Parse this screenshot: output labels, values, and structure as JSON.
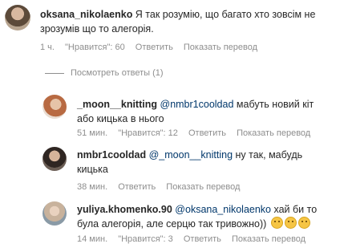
{
  "comments": [
    {
      "username": "oksana_nikolaenko",
      "text_line1": " Я так розумію, що багато хто зовсім не",
      "text_line2": "зрозумів що то алегорія.",
      "time": "1 ч.",
      "likes": "\"Нравится\": 60",
      "reply": "Ответить",
      "translate": "Показать перевод"
    }
  ],
  "replies_toggle": "Посмотреть ответы (1)",
  "replies": [
    {
      "username": "_moon__knitting",
      "mention": "@nmbr1cooldad",
      "text_line1": " мабуть новий кіт",
      "text_line2": "або кицька в нього",
      "time": "51 мин.",
      "likes": "\"Нравится\": 12",
      "reply": "Ответить",
      "translate": "Показать перевод"
    },
    {
      "username": "nmbr1cooldad",
      "mention": "@_moon__knitting",
      "text_line1": " ну так, мабудь",
      "text_line2": "кицька",
      "time": "38 мин.",
      "reply": "Ответить",
      "translate": "Показать перевод"
    },
    {
      "username": "yuliya.khomenko.90",
      "mention": "@oksana_nikolaenko",
      "text_line1": " хай би то",
      "text_line2": "була алегорія, але серцю так тривожно))",
      "emojis": [
        "sad-face-emoji",
        "sad-face-emoji",
        "sad-face-emoji"
      ],
      "time": "14 мин.",
      "likes": "\"Нравится\": 3",
      "reply": "Ответить",
      "translate": "Показать перевод"
    }
  ]
}
